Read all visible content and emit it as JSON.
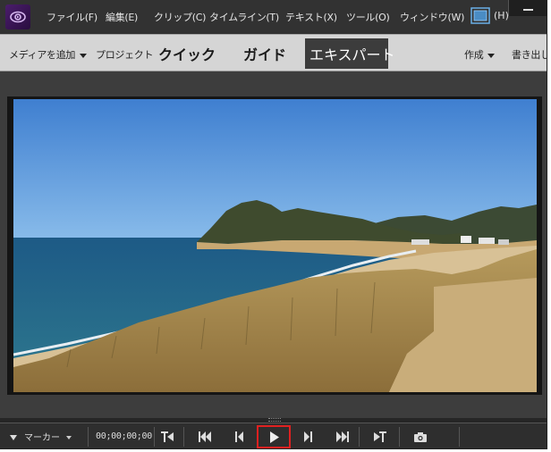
{
  "menu": {
    "items": [
      "ファイル(F)",
      "編集(E)",
      "クリップ(C)",
      "タイムライン(T)",
      "テキスト(X)",
      "ツール(O)",
      "ウィンドウ(W)"
    ],
    "help": "(H)"
  },
  "modebar": {
    "add_media": "メディアを追加",
    "project": "プロジェクト",
    "tab_quick": "クイック",
    "tab_guided": "ガイド",
    "tab_expert": "エキスパート",
    "create": "作成",
    "export": "書き出し"
  },
  "transport": {
    "marker_label": "マーカー",
    "timecode": "00;00;00;00"
  },
  "colors": {
    "accent_highlight": "#e02020",
    "active_tab_bg": "#3c3c3c"
  },
  "icons": [
    "premiere-elements-logo",
    "monitor-icon",
    "chevron-down-icon",
    "go-to-in-icon",
    "go-to-start-icon",
    "step-back-icon",
    "play-icon",
    "step-forward-icon",
    "go-to-end-icon",
    "go-to-out-icon",
    "camera-icon"
  ]
}
